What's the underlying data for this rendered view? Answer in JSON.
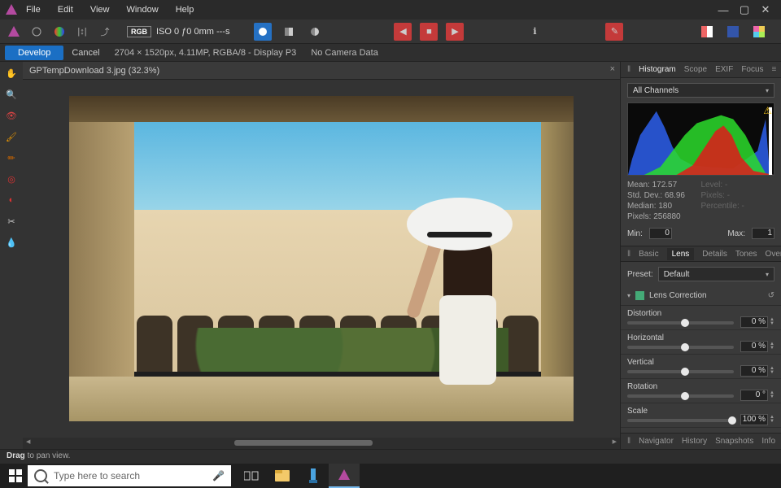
{
  "menu": {
    "file": "File",
    "edit": "Edit",
    "view": "View",
    "window": "Window",
    "help": "Help"
  },
  "toolbar": {
    "rgb": "RGB",
    "iso": "ISO 0 ƒ0 0mm ---s"
  },
  "ctx": {
    "develop": "Develop",
    "cancel": "Cancel",
    "info": "2704 × 1520px, 4.11MP, RGBA/8 - Display P3",
    "camera": "No Camera Data"
  },
  "doc": {
    "title": "GPTempDownload 3.jpg (32.3%)"
  },
  "rpanel": {
    "tabs": {
      "histogram": "Histogram",
      "scope": "Scope",
      "exif": "EXIF",
      "focus": "Focus"
    },
    "channels": "All Channels",
    "stats": {
      "mean": "Mean: 172.57",
      "sd": "Std. Dev.: 68.96",
      "median": "Median: 180",
      "pixels": "Pixels: 256880",
      "level": "Level: -",
      "pixels2": "Pixels: -",
      "perc": "Percentile: -"
    },
    "min_lbl": "Min:",
    "min": "0",
    "max_lbl": "Max:",
    "max": "1",
    "subtabs": {
      "basic": "Basic",
      "lens": "Lens",
      "details": "Details",
      "tones": "Tones",
      "overlays": "Overlays"
    },
    "preset_lbl": "Preset:",
    "preset": "Default",
    "lenscorr": "Lens Correction",
    "sliders": [
      {
        "label": "Distortion",
        "value": "0 %",
        "pos": 50
      },
      {
        "label": "Horizontal",
        "value": "0 %",
        "pos": 50
      },
      {
        "label": "Vertical",
        "value": "0 %",
        "pos": 50
      },
      {
        "label": "Rotation",
        "value": "0 °",
        "pos": 50
      },
      {
        "label": "Scale",
        "value": "100 %",
        "pos": 95
      }
    ],
    "bottom": {
      "navigator": "Navigator",
      "history": "History",
      "snapshots": "Snapshots",
      "info": "Info"
    }
  },
  "status": {
    "drag": "Drag",
    "rest": " to pan view."
  },
  "taskbar": {
    "search": "Type here to search"
  }
}
